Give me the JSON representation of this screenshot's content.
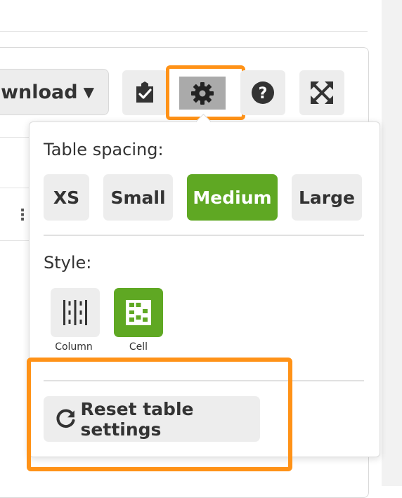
{
  "toolbar": {
    "download_label": "ownload",
    "download_caret": "▼",
    "icons": {
      "clipboard": "clipboard-check-icon",
      "settings": "gear-icon",
      "help": "question-circle-icon",
      "fullscreen": "expand-arrows-icon"
    }
  },
  "settings_popover": {
    "table_spacing_label": "Table spacing:",
    "spacing_options": [
      {
        "label": "XS",
        "active": false
      },
      {
        "label": "Small",
        "active": false
      },
      {
        "label": "Medium",
        "active": true
      },
      {
        "label": "Large",
        "active": false
      }
    ],
    "style_label": "Style:",
    "style_options": [
      {
        "label": "Column",
        "icon": "column-lines-icon",
        "active": false
      },
      {
        "label": "Cell",
        "icon": "cell-grid-icon",
        "active": true
      }
    ],
    "reset_label": "Reset table settings"
  },
  "table": {
    "row_menu_glyph": "⋮"
  },
  "colors": {
    "accent_green": "#5fa823",
    "highlight_orange": "#ff9217",
    "button_gray": "#ededed"
  }
}
